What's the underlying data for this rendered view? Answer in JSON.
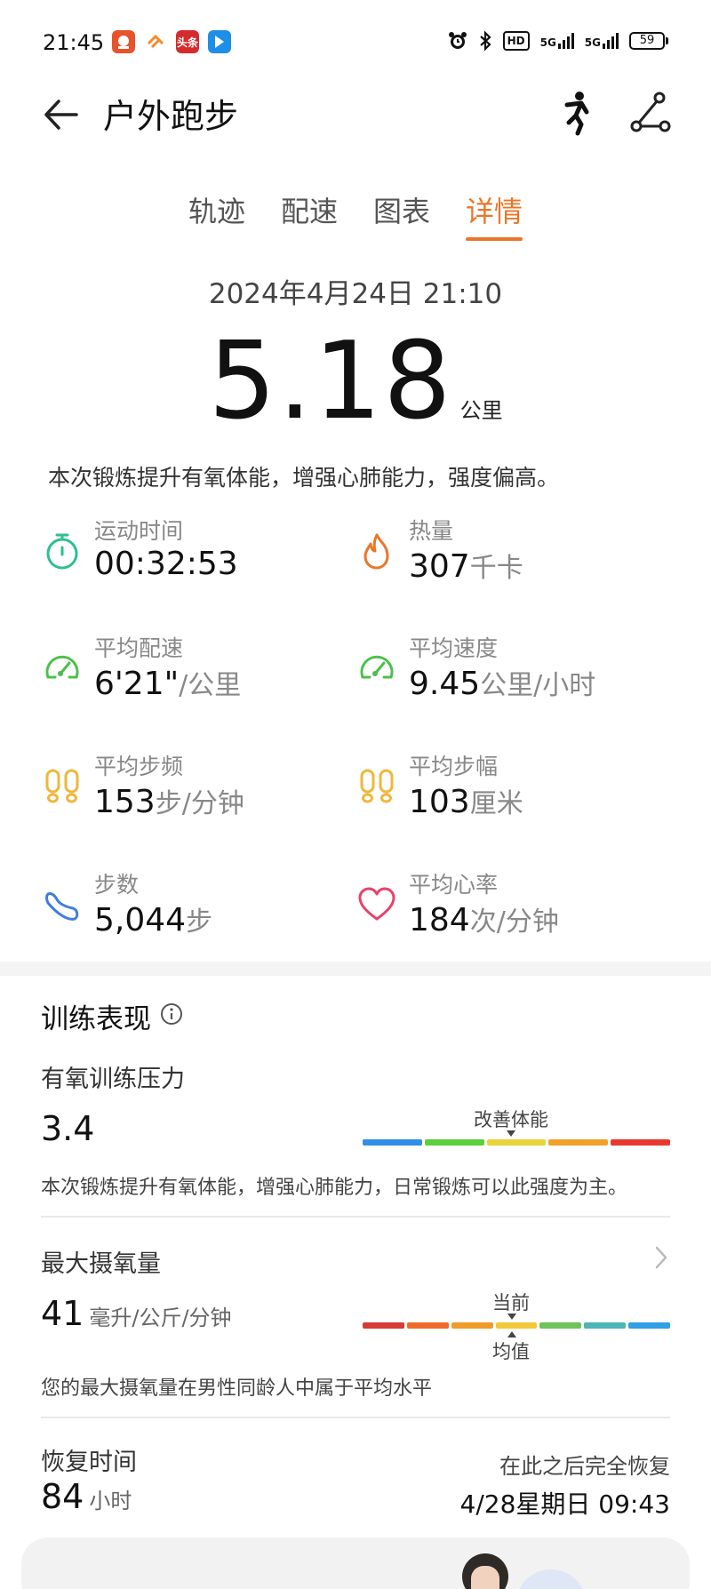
{
  "status_bar": {
    "time": "21:45",
    "apps": [
      {
        "name": "app-icon-1",
        "color": "#e8532b"
      },
      {
        "name": "app-icon-2",
        "color": "#f28a2b"
      },
      {
        "name": "toutiao-icon",
        "color": "#d52b2b",
        "text": "头条"
      },
      {
        "name": "app-icon-4",
        "color": "#1e8fe8"
      }
    ],
    "network_1": "5G",
    "network_2": "5G",
    "hd_badge": "HD",
    "battery": "59"
  },
  "header": {
    "title": "户外跑步"
  },
  "tabs": [
    {
      "label": "轨迹",
      "active": false
    },
    {
      "label": "配速",
      "active": false
    },
    {
      "label": "图表",
      "active": false
    },
    {
      "label": "详情",
      "active": true
    }
  ],
  "workout": {
    "datetime": "2024年4月24日 21:10",
    "distance": "5.18",
    "distance_unit": "公里",
    "summary": "本次锻炼提升有氧体能，增强心肺能力，强度偏高。"
  },
  "metrics": [
    {
      "label": "运动时间",
      "value": "00:32:53",
      "unit": "",
      "icon": "stopwatch-icon",
      "color": "#2dbf8f"
    },
    {
      "label": "热量",
      "value": "307",
      "unit": "千卡",
      "icon": "flame-icon",
      "color": "#e9772a"
    },
    {
      "label": "平均配速",
      "value": "6'21\"",
      "unit": "/公里",
      "icon": "speedometer-icon",
      "color": "#4cc04a"
    },
    {
      "label": "平均速度",
      "value": "9.45",
      "unit": "公里/小时",
      "icon": "speedometer-icon",
      "color": "#4cc04a"
    },
    {
      "label": "平均步频",
      "value": "153",
      "unit": "步/分钟",
      "icon": "footprints-icon",
      "color": "#f0b73c"
    },
    {
      "label": "平均步幅",
      "value": "103",
      "unit": "厘米",
      "icon": "footprints-icon",
      "color": "#f0b73c"
    },
    {
      "label": "步数",
      "value": "5,044",
      "unit": "步",
      "icon": "shoe-icon",
      "color": "#3f7de0"
    },
    {
      "label": "平均心率",
      "value": "184",
      "unit": "次/分钟",
      "icon": "heart-icon",
      "color": "#e8426b"
    }
  ],
  "training": {
    "title": "训练表现",
    "aerobic": {
      "label": "有氧训练压力",
      "value": "3.4",
      "marker_label": "改善体能",
      "marker_segment": 2,
      "scale_colors": [
        "#2f8fe6",
        "#5ccf3c",
        "#e6d43a",
        "#f0a12b",
        "#e9392f"
      ],
      "desc": "本次锻炼提升有氧体能，增强心肺能力，日常锻炼可以此强度为主。"
    },
    "vo2max": {
      "label": "最大摄氧量",
      "value": "41",
      "unit": "毫升/公斤/分钟",
      "current_label": "当前",
      "average_label": "均值",
      "current_segment": 3,
      "scale_colors": [
        "#d63b35",
        "#ef6a2a",
        "#f09a2a",
        "#f2c83a",
        "#6cc45a",
        "#4cb6b6",
        "#2f9fe6"
      ],
      "desc": "您的最大摄氧量在男性同龄人中属于平均水平"
    },
    "recovery": {
      "label": "恢复时间",
      "value": "84",
      "unit": "小时",
      "note": "在此之后完全恢复",
      "time": "4/28星期日 09:43"
    }
  }
}
